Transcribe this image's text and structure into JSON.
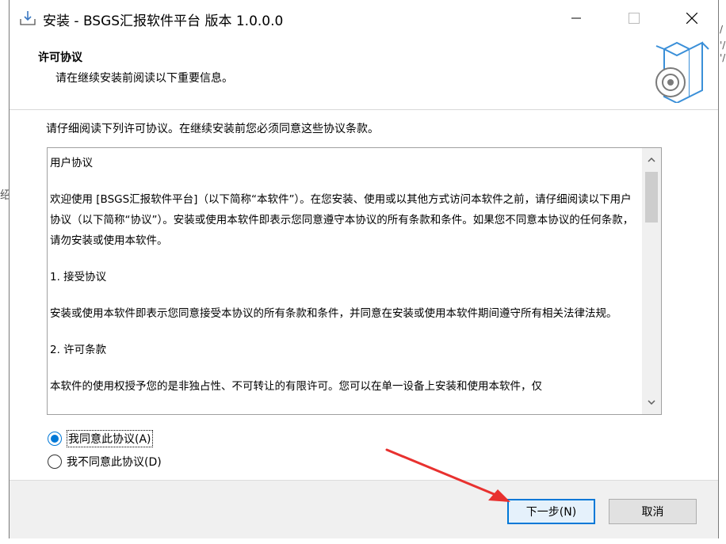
{
  "window": {
    "title": "安装 - BSGS汇报软件平台 版本 1.0.0.0"
  },
  "header": {
    "title": "许可协议",
    "subtitle": "请在继续安装前阅读以下重要信息。"
  },
  "instruction": "请仔细阅读下列许可协议。在继续安装前您必须同意这些协议条款。",
  "license": {
    "paragraphs": [
      "用户协议",
      "欢迎使用 [BSGS汇报软件平台]（以下简称“本软件”）。在您安装、使用或以其他方式访问本软件之前，请仔细阅读以下用户协议（以下简称“协议”）。安装或使用本软件即表示您同意遵守本协议的所有条款和条件。如果您不同意本协议的任何条款，请勿安装或使用本软件。",
      "1. 接受协议",
      "安装或使用本软件即表示您同意接受本协议的所有条款和条件，并同意在安装或使用本软件期间遵守所有相关法律法规。",
      "2. 许可条款",
      "本软件的使用权授予您的是非独占性、不可转让的有限许可。您可以在单一设备上安装和使用本软件，仅"
    ]
  },
  "options": {
    "accept": "我同意此协议(A)",
    "decline": "我不同意此协议(D)",
    "selected": "accept"
  },
  "buttons": {
    "next": "下一步(N)",
    "cancel": "取消"
  },
  "background": {
    "left_text": "绍",
    "right_texts": [
      "/",
      "'/",
      "'/"
    ]
  },
  "colors": {
    "accent": "#0078d7",
    "annotation_arrow": "#e8312f"
  }
}
